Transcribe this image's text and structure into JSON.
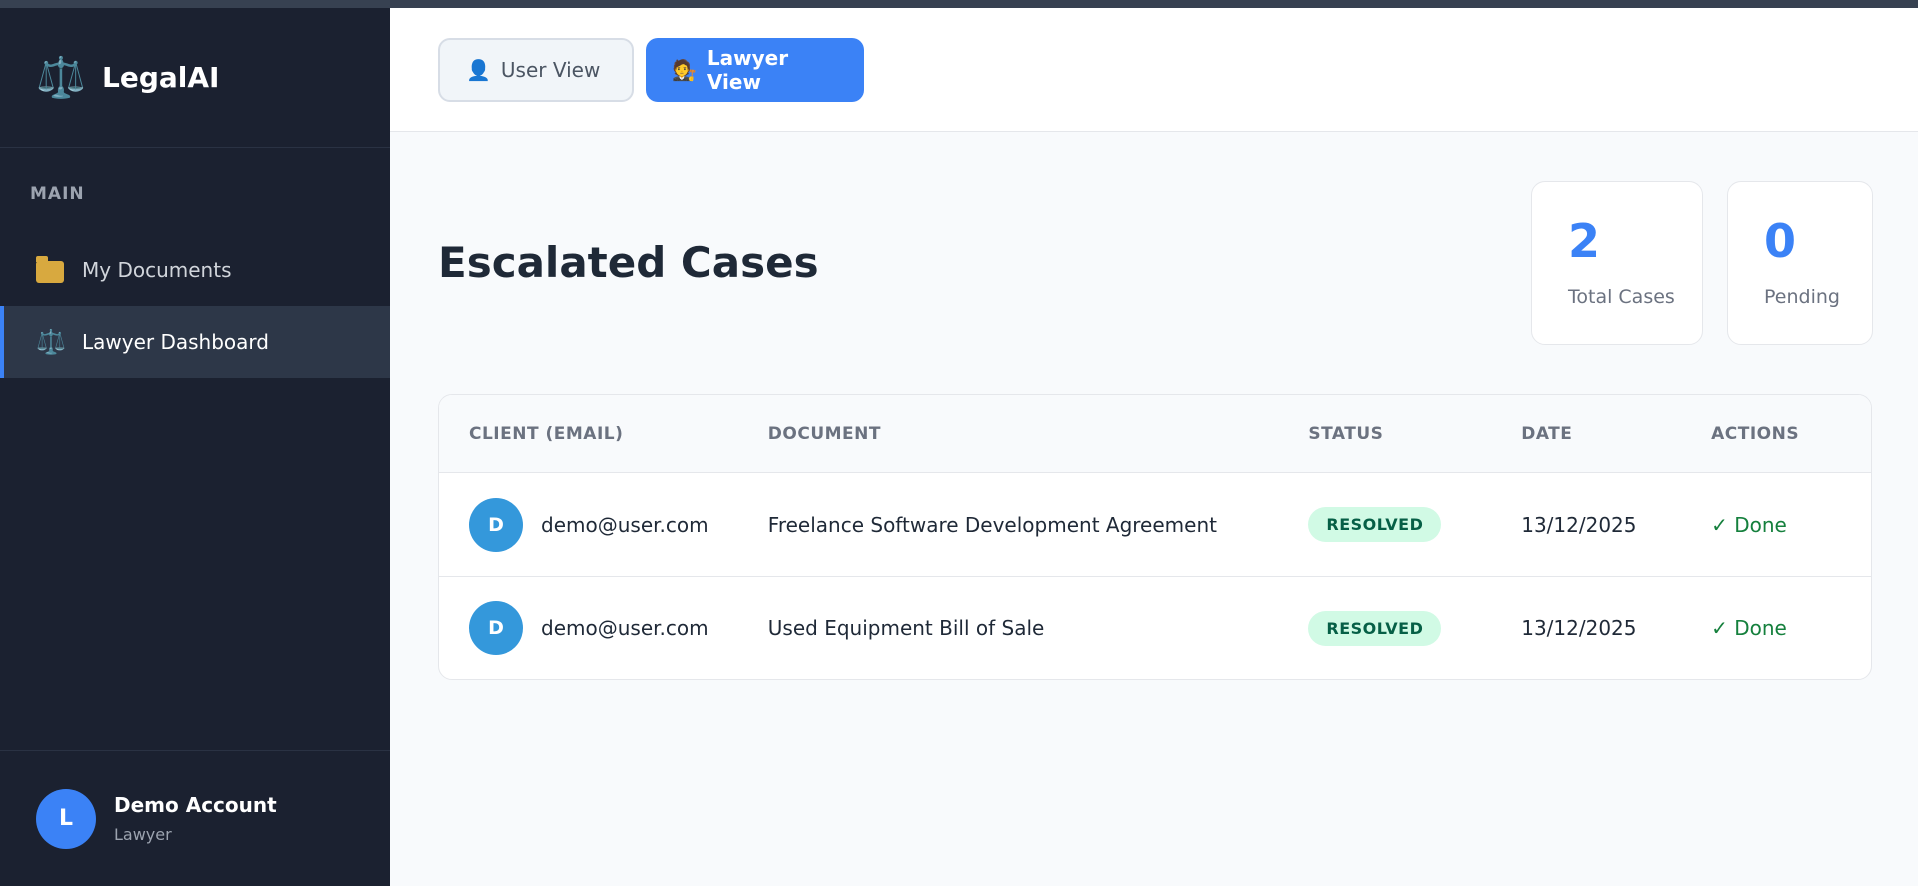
{
  "brand": {
    "icon": "⚖️",
    "title": "LegalAI"
  },
  "sidebar": {
    "section": "MAIN",
    "items": [
      {
        "label": "My Documents",
        "icon": "folder-icon"
      },
      {
        "label": "Lawyer Dashboard",
        "icon": "scales-icon",
        "glyph": "⚖️"
      }
    ]
  },
  "user": {
    "initial": "L",
    "name": "Demo Account",
    "role": "Lawyer"
  },
  "header": {
    "user_view": {
      "label": "User View",
      "glyph": "👤"
    },
    "lawyer_view": {
      "label": "Lawyer View",
      "glyph": "🧑‍⚖️"
    }
  },
  "main": {
    "title": "Escalated Cases",
    "stats": [
      {
        "value": "2",
        "label": "Total Cases"
      },
      {
        "value": "0",
        "label": "Pending"
      }
    ],
    "table": {
      "columns": [
        "CLIENT (EMAIL)",
        "DOCUMENT",
        "STATUS",
        "DATE",
        "ACTIONS"
      ],
      "rows": [
        {
          "initial": "D",
          "email": "demo@user.com",
          "document": "Freelance Software Development Agreement",
          "status": "RESOLVED",
          "date": "13/12/2025",
          "action": "✓ Done"
        },
        {
          "initial": "D",
          "email": "demo@user.com",
          "document": "Used Equipment Bill of Sale",
          "status": "RESOLVED",
          "date": "13/12/2025",
          "action": "✓ Done"
        }
      ]
    }
  },
  "colors": {
    "accent": "#3b82f6",
    "sidebar_bg": "#1b2130",
    "success": "#15803d",
    "badge_bg": "#d1fae5"
  }
}
